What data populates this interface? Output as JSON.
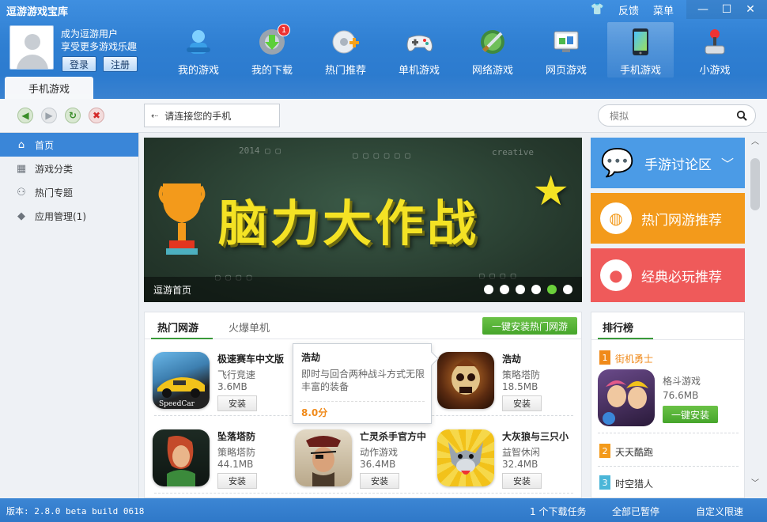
{
  "app": {
    "title": "逗游游戏宝库"
  },
  "topbar": {
    "feedback": "反馈",
    "menu": "菜单",
    "minimize": "—",
    "maximize": "☐",
    "close": "✕"
  },
  "user": {
    "line1": "成为逗游用户",
    "line2": "享受更多游戏乐趣",
    "login": "登录",
    "register": "注册"
  },
  "nav": {
    "items": [
      {
        "label": "我的游戏",
        "icon": "my-games-icon"
      },
      {
        "label": "我的下载",
        "icon": "download-icon",
        "badge": "1"
      },
      {
        "label": "热门推荐",
        "icon": "hot-recommend-icon"
      },
      {
        "label": "单机游戏",
        "icon": "gamepad-icon"
      },
      {
        "label": "网络游戏",
        "icon": "online-game-icon"
      },
      {
        "label": "网页游戏",
        "icon": "web-game-icon"
      },
      {
        "label": "手机游戏",
        "icon": "mobile-game-icon"
      },
      {
        "label": "小游戏",
        "icon": "joystick-icon"
      }
    ],
    "active_tab": "手机游戏"
  },
  "toolbar": {
    "phone_prompt": "请连接您的手机",
    "search_placeholder": "模拟"
  },
  "sidebar": {
    "items": [
      {
        "label": "首页",
        "icon": "home-icon"
      },
      {
        "label": "游戏分类",
        "icon": "grid-icon"
      },
      {
        "label": "热门专题",
        "icon": "topic-icon"
      },
      {
        "label": "应用管理(1)",
        "icon": "cube-icon"
      }
    ]
  },
  "banner": {
    "title": "脑力大作战",
    "caption": "逗游首页",
    "slides": 6,
    "active_slide": 5
  },
  "promos": [
    {
      "label": "手游讨论区",
      "color": "#4b9be6",
      "icon": "chat-icon"
    },
    {
      "label": "热门网游推荐",
      "color": "#f39a1b",
      "icon": "basketball-icon"
    },
    {
      "label": "经典必玩推荐",
      "color": "#ef5a5a",
      "icon": "mushroom-icon"
    }
  ],
  "games_panel": {
    "tabs": [
      "热门网游",
      "火爆单机"
    ],
    "install_all": "一键安装热门网游",
    "games": [
      {
        "name": "极速赛车中文版",
        "category": "飞行竞速",
        "size": "3.6MB",
        "install": "安装"
      },
      {
        "name": "浩劫",
        "category": "策略塔防",
        "size": "18.5MB",
        "install": "安装"
      },
      {
        "name": "坠落塔防",
        "category": "策略塔防",
        "size": "44.1MB",
        "install": "安装"
      },
      {
        "name": "亡灵杀手官方中",
        "category": "动作游戏",
        "size": "36.4MB",
        "install": "安装"
      },
      {
        "name": "大灰狼与三只小",
        "category": "益智休闲",
        "size": "32.4MB",
        "install": "安装"
      }
    ]
  },
  "tooltip": {
    "title": "浩劫",
    "description": "即时与回合两种战斗方式无限丰富的装备",
    "score": "8.0分"
  },
  "ranking": {
    "title": "排行榜",
    "items": [
      {
        "rank": "1",
        "name": "街机勇士",
        "category": "格斗游戏",
        "size": "76.6MB",
        "install": "一键安装"
      },
      {
        "rank": "2",
        "name": "天天酷跑"
      },
      {
        "rank": "3",
        "name": "时空猎人"
      }
    ]
  },
  "status": {
    "version": "版本: 2.8.0 beta build 0618",
    "tasks": "1 个下载任务",
    "pause_all": "全部已暂停",
    "speed": "自定义限速"
  }
}
